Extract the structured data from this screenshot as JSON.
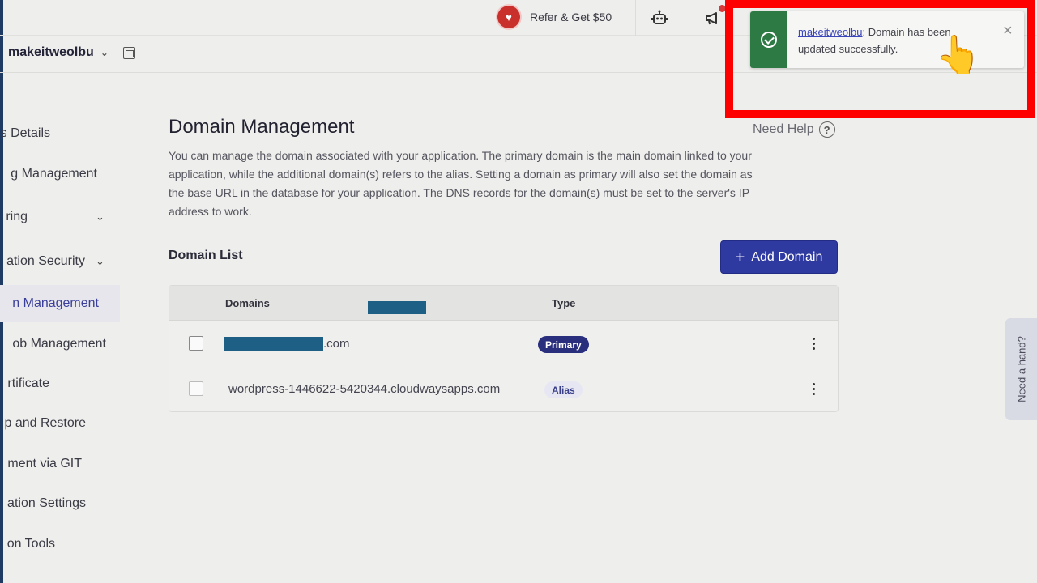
{
  "topbar": {
    "refer_label": "Refer & Get $50",
    "icons": [
      "heart-icon",
      "robot-icon",
      "megaphone-icon"
    ]
  },
  "app": {
    "name": "makeitweolbu"
  },
  "sidebar": {
    "items": [
      {
        "label": "s Details",
        "active": false
      },
      {
        "label": "g Management",
        "active": false
      },
      {
        "label": "ring",
        "active": false,
        "caret": true
      },
      {
        "label": "ation Security",
        "active": false,
        "caret": true
      },
      {
        "label": "n Management",
        "active": true
      },
      {
        "label": "ob Management",
        "active": false
      },
      {
        "label": "rtificate",
        "active": false
      },
      {
        "label": "p and Restore",
        "active": false
      },
      {
        "label": "ment via GIT",
        "active": false
      },
      {
        "label": "ation Settings",
        "active": false
      },
      {
        "label": "on Tools",
        "active": false
      }
    ]
  },
  "main": {
    "title": "Domain Management",
    "help_label": "Need Help",
    "description": "You can manage the domain associated with your application. The primary domain is the main domain linked to your application, while the additional domain(s) refers to the alias. Setting a domain as primary will also set the domain as the base URL in the database for your application. The DNS records for the domain(s) must be set to the server's IP address to work.",
    "list_title": "Domain List",
    "add_button": "Add Domain",
    "table": {
      "columns": [
        "Domains",
        "Type"
      ],
      "rows": [
        {
          "domain_suffix": ".com",
          "type": "Primary"
        },
        {
          "domain": "wordpress-1446622-5420344.cloudwaysapps.com",
          "type": "Alias"
        }
      ]
    }
  },
  "need_hand": "Need a hand?",
  "toast": {
    "link": "makeitweolbu",
    "message": ": Domain has been updated successfully.",
    "close": "×"
  },
  "colors": {
    "accent": "#2f3aa0",
    "success": "#2d7a45",
    "highlight_border": "#ff0000",
    "redaction": "#1e5f86"
  }
}
